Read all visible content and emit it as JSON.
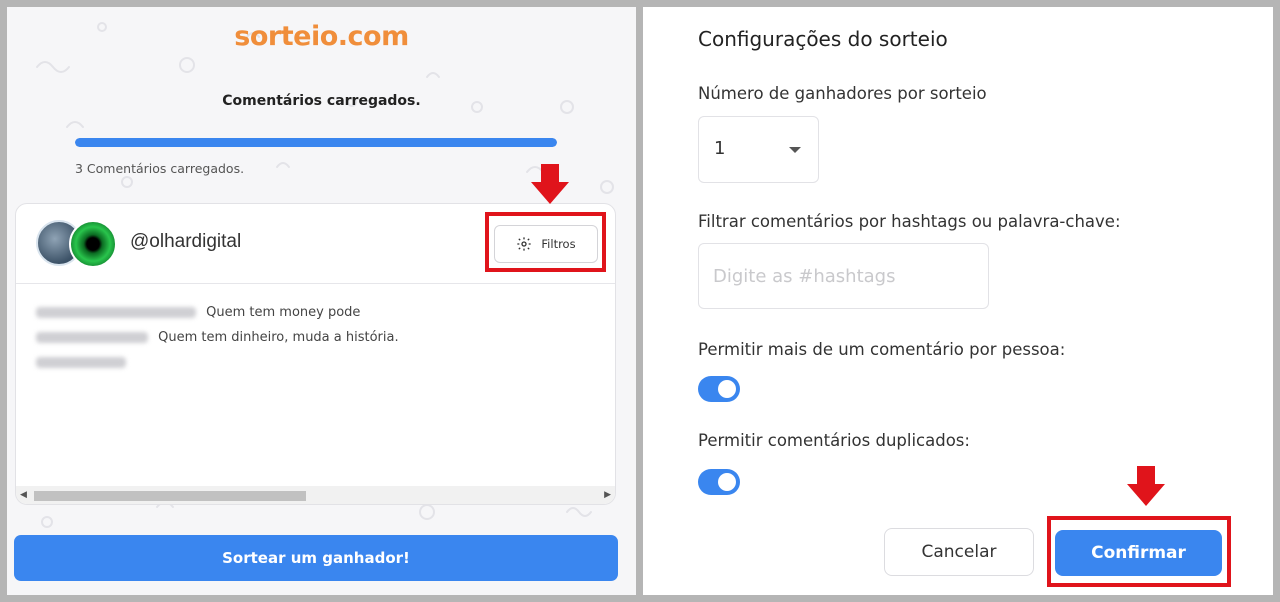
{
  "left_panel": {
    "logo": "sorteio.com",
    "status_title": "Comentários carregados.",
    "progress_fraction": 1.0,
    "progress_text": "3 Comentários carregados.",
    "account_handle": "@olhardigital",
    "filters_label": "Filtros",
    "comments": [
      {
        "text": "Quem tem money pode"
      },
      {
        "text": "Quem tem dinheiro, muda a história."
      },
      {
        "text": ""
      }
    ],
    "draw_button_label": "Sortear um ganhador!"
  },
  "right_panel": {
    "title": "Configurações do sorteio",
    "winners_label": "Número de ganhadores por sorteio",
    "winners_value": "1",
    "hashtag_label": "Filtrar comentários por hashtags ou palavra-chave:",
    "hashtag_placeholder": "Digite as #hashtags",
    "allow_multiple_label": "Permitir mais de um comentário por pessoa:",
    "allow_multiple_on": true,
    "allow_duplicates_label": "Permitir comentários duplicados:",
    "allow_duplicates_on": true,
    "cancel_label": "Cancelar",
    "confirm_label": "Confirmar"
  },
  "colors": {
    "accent": "#3a86ef",
    "logo": "#f08e3b",
    "annotation": "#e0141b"
  }
}
